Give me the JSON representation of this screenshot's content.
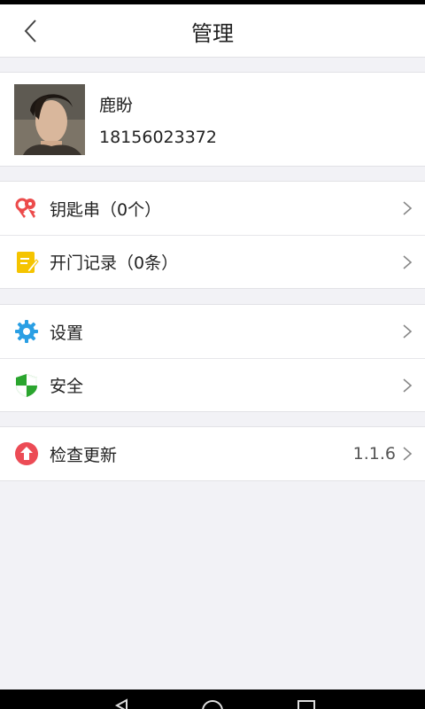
{
  "header": {
    "title": "管理",
    "back_icon": "back-chevron-icon"
  },
  "profile": {
    "name": "鹿盼",
    "phone": "18156023372"
  },
  "menu_groups": [
    {
      "items": [
        {
          "label": "钥匙串（0个）",
          "icon": "keychain-icon",
          "color": "#ec4b4b"
        },
        {
          "label": "开门记录（0条）",
          "icon": "notepad-icon",
          "color": "#f5c400"
        }
      ]
    },
    {
      "items": [
        {
          "label": "设置",
          "icon": "gear-icon",
          "color": "#2a9fe4"
        },
        {
          "label": "安全",
          "icon": "shield-icon",
          "color": "#2aa52e"
        }
      ]
    },
    {
      "items": [
        {
          "label": "检查更新",
          "value": "1.1.6",
          "icon": "upload-arrow-icon",
          "color": "#ec4b55"
        }
      ]
    }
  ]
}
